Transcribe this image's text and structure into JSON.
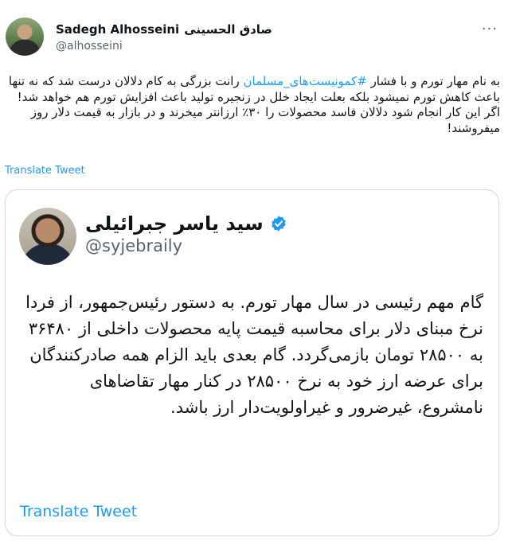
{
  "author": {
    "name": "Sadegh Alhosseini",
    "name_fa": "صادق الحسینی",
    "handle": "@alhosseini"
  },
  "more_icon": "more-dots-icon",
  "tweet": {
    "text_before_hashtag": "به نام مهار تورم و با فشار ",
    "hashtag": "#کمونیست‌های_مسلمان",
    "text_after_hashtag": " رانت بزرگی به کام دلالان درست شد که نه تنها باعث کاهش تورم نمیشود بلکه بعلت ایجاد خلل در زنجیره تولید باعث افزایش تورم هم خواهد شد!",
    "text_line2": "اگر این کار انجام شود دلالان فاسد محصولات را ۳۰٪ ارزانتر میخرند و در بازار به قیمت دلار روز میفروشند!"
  },
  "translate_label": "Translate Tweet",
  "quoted": {
    "name": "سید یاسر جبرائیلی",
    "handle": "@syjebraily",
    "verified": true,
    "text": "گام مهم رئیسی در سال مهار تورم. به دستور رئیس‌جمهور، از فردا نرخ مبنای دلار برای محاسبه قیمت پایه محصولات داخلی از ۳۶۴۸۰ به ۲۸۵۰۰ تومان بازمی‌گردد. گام بعدی باید الزام همه صادرکنندگان برای عرضه ارز خود به نرخ ۲۸۵۰۰ در کنار مهار تقاضاهای نامشروع، غیرضرور و غیراولویت‌دار ارز باشد.",
    "translate_label": "Translate Tweet"
  },
  "colors": {
    "link": "#1d9bf0",
    "text": "#0f1419",
    "muted": "#536471",
    "border": "#cfd9de"
  }
}
